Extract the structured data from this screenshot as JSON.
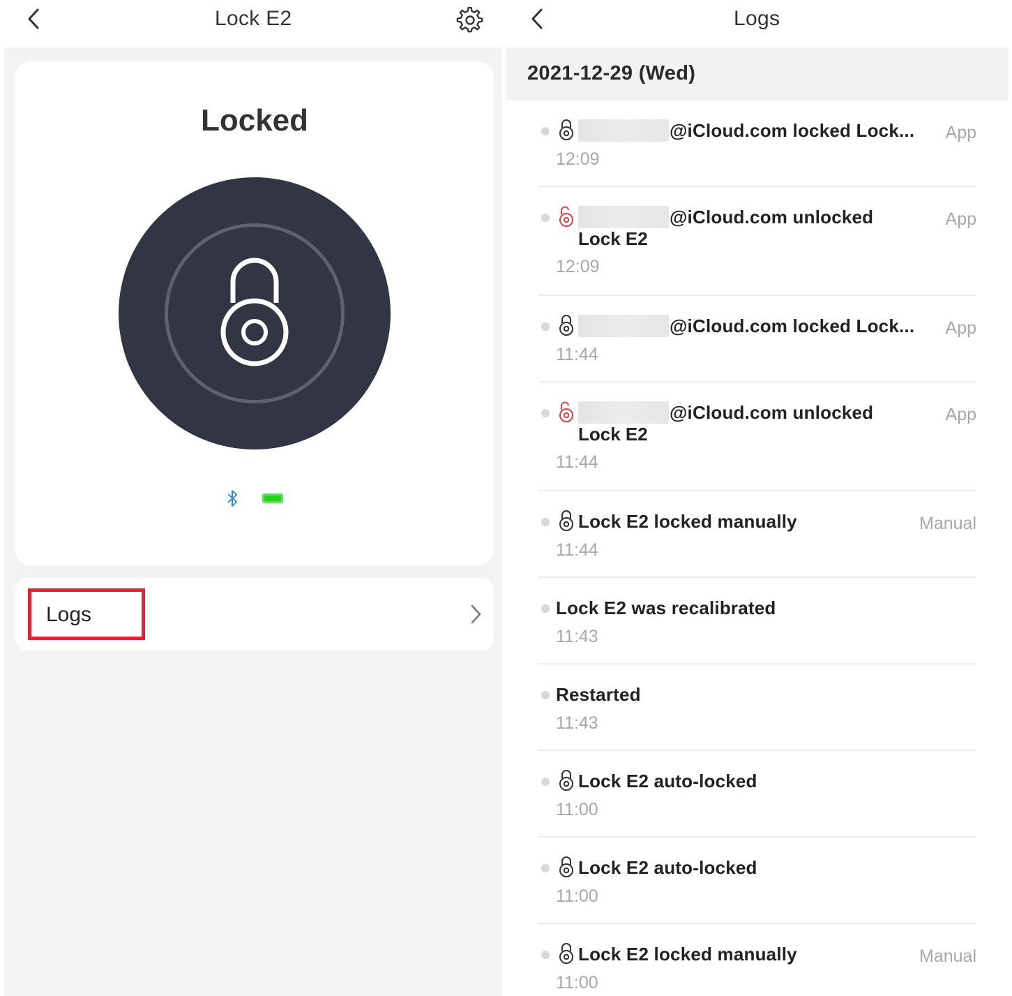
{
  "lock_screen": {
    "title": "Lock E2",
    "status": "Locked",
    "logs_label": "Logs"
  },
  "logs_screen": {
    "title": "Logs",
    "date": "2021-12-29 (Wed)",
    "entries": [
      {
        "icon": "locked-icon",
        "message": "@iCloud.com locked Lock...",
        "message2": "",
        "time": "12:09",
        "source": "App",
        "redacted": true
      },
      {
        "icon": "unlocked-icon",
        "message": "@iCloud.com unlocked",
        "message2": "Lock E2",
        "time": "12:09",
        "source": "App",
        "redacted": true
      },
      {
        "icon": "locked-icon",
        "message": "@iCloud.com locked Lock...",
        "message2": "",
        "time": "11:44",
        "source": "App",
        "redacted": true
      },
      {
        "icon": "unlocked-icon",
        "message": "@iCloud.com unlocked",
        "message2": "Lock E2",
        "time": "11:44",
        "source": "App",
        "redacted": true
      },
      {
        "icon": "locked-icon",
        "message": "Lock E2 locked manually",
        "message2": "",
        "time": "11:44",
        "source": "Manual",
        "redacted": false
      },
      {
        "icon": "",
        "message": "Lock E2 was recalibrated",
        "message2": "",
        "time": "11:43",
        "source": "",
        "redacted": false
      },
      {
        "icon": "",
        "message": "Restarted",
        "message2": "",
        "time": "11:43",
        "source": "",
        "redacted": false
      },
      {
        "icon": "locked-icon",
        "message": "Lock E2 auto-locked",
        "message2": "",
        "time": "11:00",
        "source": "",
        "redacted": false
      },
      {
        "icon": "locked-icon",
        "message": "Lock E2 auto-locked",
        "message2": "",
        "time": "11:00",
        "source": "",
        "redacted": false
      },
      {
        "icon": "locked-icon",
        "message": "Lock E2 locked manually",
        "message2": "",
        "time": "11:00",
        "source": "Manual",
        "redacted": false
      }
    ]
  },
  "colors": {
    "dial": "#323644",
    "highlight": "#e52331",
    "unlocked_icon": "#e0404a",
    "bluetooth": "#3d8fd0",
    "battery": "#26d020"
  }
}
